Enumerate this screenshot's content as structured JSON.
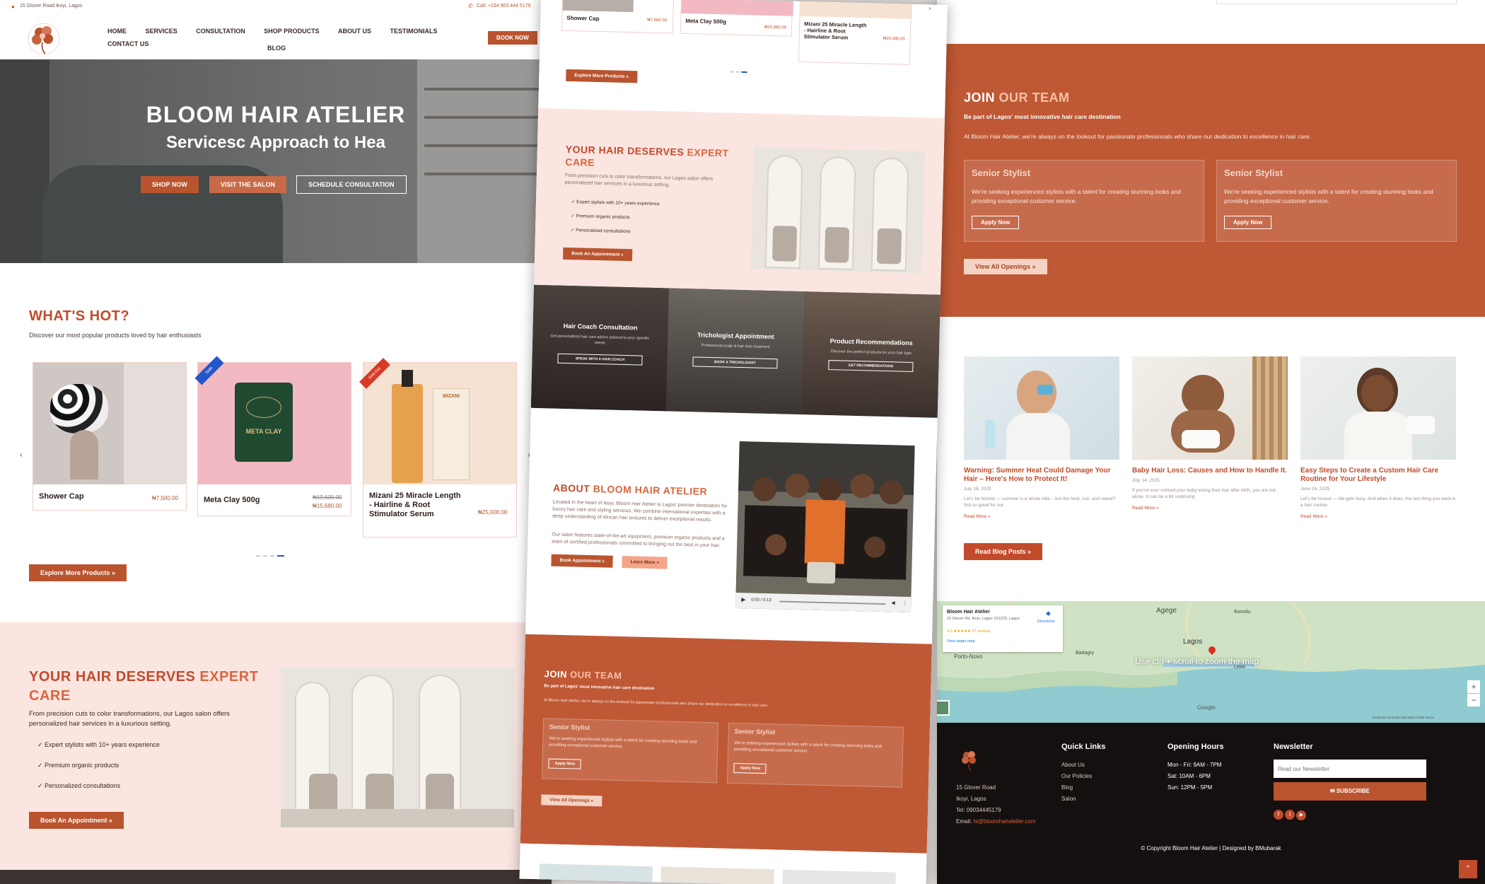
{
  "topbar": {
    "address": "15 Glover Road Ikoyi, Lagos",
    "phone": "Call: +234 903 444 5179"
  },
  "nav": {
    "items": [
      "HOME",
      "SERVICES",
      "CONSULTATION",
      "SHOP PRODUCTS",
      "ABOUT US",
      "TESTIMONIALS",
      "CONTACT US"
    ],
    "blog": "BLOG",
    "book_now": "BOOK NOW"
  },
  "hero": {
    "title": "BLOOM HAIR ATELIER",
    "subtitle": "Servicesc Approach to Hea",
    "shop_now": "SHOP NOW",
    "visit_salon": "VISIT THE SALON",
    "schedule": "SCHEDULE CONSULTATION"
  },
  "hot": {
    "title": "WHAT'S HOT?",
    "subtitle": "Discover our most popular products loved by hair enthusiasts",
    "products": [
      {
        "name": "Shower Cap",
        "price": "₦7,500.00",
        "old_price": ""
      },
      {
        "name": "Meta Clay 500g",
        "price": "₦15,680.00",
        "old_price": "₦19,600.00",
        "badge": "Sale"
      },
      {
        "name": "Mizani 25 Miracle Length - Hairline & Root Stimulator Serum",
        "price": "₦25,000.00",
        "old_price": "",
        "badge": "Sold Out"
      }
    ],
    "explore": "Explore More Products »"
  },
  "expert": {
    "title_a": "YOUR HAIR DESERVES ",
    "title_b": "EXPERT CARE",
    "desc": "From precision cuts to color transformations, our Lagos salon offers personalized hair services in a luxurious setting.",
    "bullets": [
      "✓ Expert stylists with 10+ years experience",
      "✓ Premium organic products",
      "✓ Personalized consultations"
    ],
    "cta": "Book An Appointment »"
  },
  "services": [
    {
      "title": "Hair Coach Consultation",
      "desc": "Get personalized hair care advice tailored to your specific needs",
      "cta": "SPEAK WITH A HAIR COACH"
    },
    {
      "title": "Trichologist Appointment",
      "desc": "Professional scalp & hair loss treatment",
      "cta": "BOOK A TRICHOLOGIST"
    },
    {
      "title": "Product Recommendations",
      "desc": "Discover the perfect products for your hair type",
      "cta": "GET RECOMMENDATIONS"
    }
  ],
  "about": {
    "title_a": "ABOUT ",
    "title_b": "BLOOM HAIR ATELIER",
    "p1": "Located in the heart of Ikoyi, Bloom Hair Atelier is Lagos' premier destination for luxury hair care and styling services. We combine international expertise with a deep understanding of African hair textures to deliver exceptional results.",
    "p2": "Our salon features state-of-the-art equipment, premium organic products and a team of certified professionals committed to bringing out the best in your hair.",
    "book": "Book Appointment »",
    "learn": "Learn More »",
    "video_time": "0:00 / 0:13"
  },
  "team": {
    "title_a": "JOIN ",
    "title_b": "OUR TEAM",
    "tagline": "Be part of Lagos' most innovative hair care destination",
    "desc": "At Bloom Hair Atelier, we're always on the lookout for passionate professionals who share our dedication to excellence in hair care.",
    "jobs": [
      {
        "title": "Senior Stylist",
        "desc": "We're seeking experienced stylists with a talent for creating stunning looks and providing exceptional customer service.",
        "apply": "Apply Now"
      },
      {
        "title": "Senior Stylist",
        "desc": "We're seeking experienced stylists with a talent for creating stunning looks and providing exceptional customer service.",
        "apply": "Apply Now"
      }
    ],
    "view_all": "View All Openings »"
  },
  "blog": {
    "posts": [
      {
        "title": "Warning: Summer Heat Could Damage Your Hair – Here's How to Protect It!",
        "date": "July 18, 2025",
        "excerpt": "Let's be honest — summer is a whole vibe... but the heat, sun, and sweat? Not so great for our",
        "read": "Read More »"
      },
      {
        "title": "Baby Hair Loss: Causes and How to Handle It.",
        "date": "July 14, 2025",
        "excerpt": "If you've ever noticed your baby losing their hair after birth, you are not alone. It can be a bit surprising",
        "read": "Read More »"
      },
      {
        "title": "Easy Steps to Create a Custom Hair Care Routine for Your Lifestyle",
        "date": "June 26, 2025",
        "excerpt": "Let's be honest — life gets busy. And when it does, the last thing you want is a hair routine",
        "read": "Read More »"
      }
    ],
    "cta": "Read Blog Posts »"
  },
  "map": {
    "place": "Bloom Hair Atelier",
    "addr": "15 Glover Rd, Ikoyi, Lagos 101233, Lagos",
    "rating": "4.5 ★★★★★  27 reviews",
    "larger": "View larger map",
    "directions": "Directions",
    "hint": "Use ctrl + scroll to zoom the map",
    "labels": [
      "Agege",
      "Ikorodu",
      "Porto-Novo",
      "Lagos",
      "Badagry",
      "Lekki"
    ],
    "google": "Google",
    "zoom_in": "+",
    "zoom_out": "−",
    "terms": "Keyboard shortcuts   Map data ©2025   Terms"
  },
  "footer": {
    "address": [
      "15 Glover Road",
      "Ikoyi, Lagos"
    ],
    "tel": "Tel: 09034445179",
    "email_label": "Email: ",
    "email": "hi@bloomhairatelier.com",
    "quick_title": "Quick Links",
    "quick": [
      "About Us",
      "Our Policies",
      "Blog",
      "Salon"
    ],
    "hours_title": "Opening Hours",
    "hours": [
      "Mon - Fri: 9AM - 7PM",
      "Sat: 10AM - 6PM",
      "Sun: 12PM - 5PM"
    ],
    "news_title": "Newsletter",
    "news_placeholder": "Read our Newsletter",
    "subscribe": "✉ SUBSCRIBE",
    "copyright": "© Copyright Bloom Hair Atelier | Designed by BMubarak"
  },
  "colors": {
    "accent": "#b9542f",
    "rust": "#bf5834",
    "pink": "#fbe5e1",
    "dark": "#151010"
  }
}
